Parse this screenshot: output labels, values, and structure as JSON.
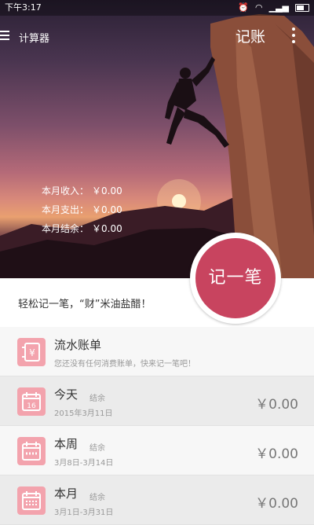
{
  "status_bar": {
    "time": "下午3:17",
    "icons": [
      "alarm-icon",
      "wifi-icon",
      "signal-icon",
      "battery-icon"
    ]
  },
  "app_bar": {
    "menu_icon": "hamburger-menu-icon",
    "calculator_label": "计算器",
    "title": "记账",
    "more_icon": "more-vert-icon"
  },
  "summary": [
    {
      "label": "本月收入：",
      "value": "￥0.00"
    },
    {
      "label": "本月支出：",
      "value": "￥0.00"
    },
    {
      "label": "本月结余：",
      "value": "￥0.00"
    }
  ],
  "fab": {
    "label": "记一笔"
  },
  "slogan": "轻松记一笔，“财”米油盐醋！",
  "list": [
    {
      "icon": "wallet-icon",
      "title": "流水账单",
      "tag": "",
      "sub": "您还没有任何消费账单，快来记一笔吧！",
      "amount": ""
    },
    {
      "icon": "calendar-day-icon",
      "icon_text": "16",
      "title": "今天",
      "tag": "结余",
      "sub": "2015年3月11日",
      "amount": "￥0.00"
    },
    {
      "icon": "calendar-week-icon",
      "title": "本周",
      "tag": "结余",
      "sub": "3月8日-3月14日",
      "amount": "￥0.00"
    },
    {
      "icon": "calendar-month-icon",
      "title": "本月",
      "tag": "结余",
      "sub": "3月1日-3月31日",
      "amount": "￥0.00"
    }
  ],
  "colors": {
    "accent": "#c8445f",
    "icon_bg": "#f3a3ad"
  }
}
